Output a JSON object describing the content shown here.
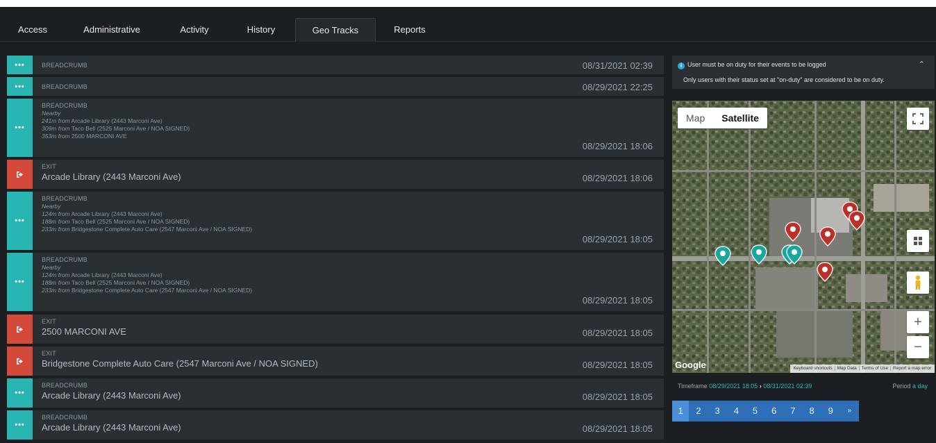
{
  "tabs": [
    {
      "label": "Access",
      "active": false
    },
    {
      "label": "Administrative",
      "active": false
    },
    {
      "label": "Activity",
      "active": false
    },
    {
      "label": "History",
      "active": false
    },
    {
      "label": "Geo Tracks",
      "active": true
    },
    {
      "label": "Reports",
      "active": false
    }
  ],
  "events": [
    {
      "kind": "breadcrumb",
      "icon": "•••",
      "type": "BREADCRUMB",
      "place": "",
      "nearby_label": "",
      "nearby": [],
      "timestamp": "08/31/2021  02:39"
    },
    {
      "kind": "breadcrumb",
      "icon": "•••",
      "type": "BREADCRUMB",
      "place": "",
      "nearby_label": "",
      "nearby": [],
      "timestamp": "08/29/2021  22:25"
    },
    {
      "kind": "breadcrumb",
      "icon": "•••",
      "type": "BREADCRUMB",
      "place": "",
      "nearby_label": "Nearby",
      "nearby": [
        {
          "dist": "241m from",
          "name": "Arcade Library (2443 Marconi Ave)"
        },
        {
          "dist": "309m from",
          "name": "Taco Bell (2525 Marconi Ave / NOA SIGNED)"
        },
        {
          "dist": "353m from",
          "name": "2500 MARCONI AVE"
        }
      ],
      "timestamp": "08/29/2021  18:06"
    },
    {
      "kind": "exit",
      "icon": "exit-icon",
      "type": "EXIT",
      "place": "Arcade Library (2443 Marconi Ave)",
      "nearby_label": "",
      "nearby": [],
      "timestamp": "08/29/2021  18:06"
    },
    {
      "kind": "breadcrumb",
      "icon": "•••",
      "type": "BREADCRUMB",
      "place": "",
      "nearby_label": "Nearby",
      "nearby": [
        {
          "dist": "124m from",
          "name": "Arcade Library (2443 Marconi Ave)"
        },
        {
          "dist": "188m from",
          "name": "Taco Bell (2525 Marconi Ave / NOA SIGNED)"
        },
        {
          "dist": "233m from",
          "name": "Bridgestone Complete Auto Care (2547 Marconi Ave / NOA SIGNED)"
        }
      ],
      "timestamp": "08/29/2021  18:05"
    },
    {
      "kind": "breadcrumb",
      "icon": "•••",
      "type": "BREADCRUMB",
      "place": "",
      "nearby_label": "Nearby",
      "nearby": [
        {
          "dist": "124m from",
          "name": "Arcade Library (2443 Marconi Ave)"
        },
        {
          "dist": "188m from",
          "name": "Taco Bell (2525 Marconi Ave / NOA SIGNED)"
        },
        {
          "dist": "233m from",
          "name": "Bridgestone Complete Auto Care (2547 Marconi Ave / NOA SIGNED)"
        }
      ],
      "timestamp": "08/29/2021  18:05"
    },
    {
      "kind": "exit",
      "icon": "exit-icon",
      "type": "EXIT",
      "place": "2500 MARCONI AVE",
      "nearby_label": "",
      "nearby": [],
      "timestamp": "08/29/2021  18:05"
    },
    {
      "kind": "exit",
      "icon": "exit-icon",
      "type": "EXIT",
      "place": "Bridgestone Complete Auto Care (2547 Marconi Ave / NOA SIGNED)",
      "nearby_label": "",
      "nearby": [],
      "timestamp": "08/29/2021  18:05"
    },
    {
      "kind": "breadcrumb",
      "icon": "•••",
      "type": "BREADCRUMB",
      "place": "Arcade Library (2443 Marconi Ave)",
      "nearby_label": "",
      "nearby": [],
      "timestamp": "08/29/2021  18:05"
    },
    {
      "kind": "breadcrumb",
      "icon": "•••",
      "type": "BREADCRUMB",
      "place": "Arcade Library (2443 Marconi Ave)",
      "nearby_label": "",
      "nearby": [],
      "timestamp": "08/29/2021  18:05"
    }
  ],
  "notice": {
    "line1": "User must be on duty for their events to be logged",
    "line2": "Only users with their status set at \"on-duty\" are considered to be on duty.",
    "info_icon": "info-icon",
    "collapse_icon": "chevron-up-icon"
  },
  "map": {
    "type_options": [
      "Map",
      "Satellite"
    ],
    "selected_type": "Satellite",
    "logo": "Google",
    "footer_links": [
      "Keyboard shortcuts",
      "Map Data",
      "Terms of Use",
      "Report a map error"
    ],
    "zoom_in": "+",
    "zoom_out": "−",
    "colors": {
      "teal_pin": "#1aa59d",
      "red_pin": "#b8322a"
    }
  },
  "timeframe": {
    "label": "Timeframe",
    "start": "08/29/2021  18:05",
    "arrow": "›",
    "end": "08/31/2021  02:39",
    "period_label": "Period",
    "period_value": "a day"
  },
  "pagination": {
    "pages": [
      "1",
      "2",
      "3",
      "4",
      "5",
      "6",
      "7",
      "8",
      "9"
    ],
    "current": "1",
    "next": "»"
  },
  "colors": {
    "accent": "#29b6b2",
    "exit": "#d44a3a",
    "pager": "#2f6fb7"
  }
}
